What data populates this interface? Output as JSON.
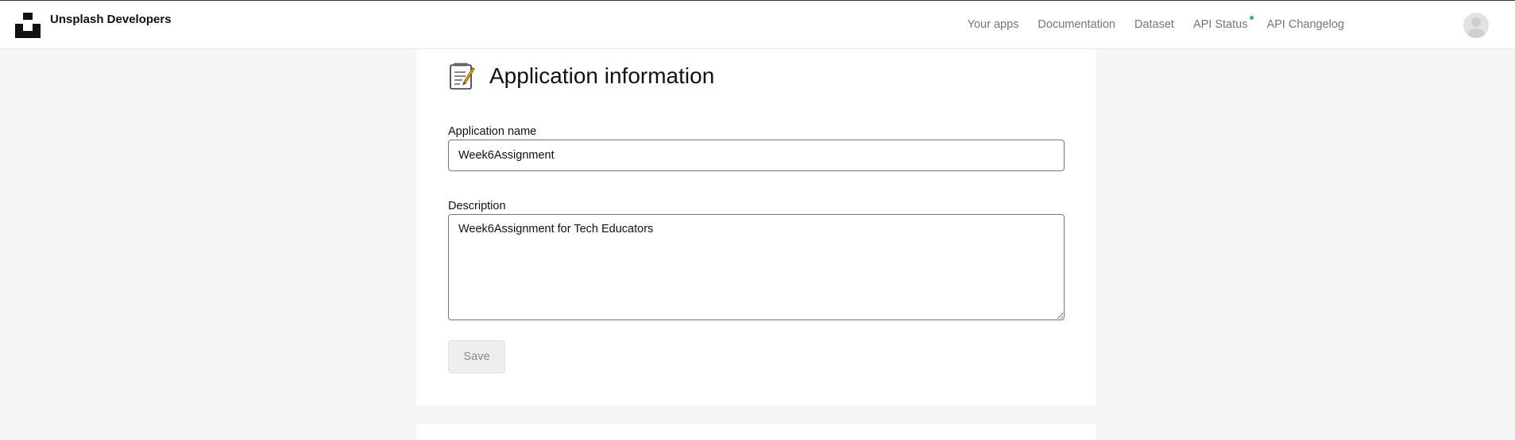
{
  "header": {
    "brand_name": "Unsplash Developers",
    "nav": [
      {
        "label": "Your apps"
      },
      {
        "label": "Documentation"
      },
      {
        "label": "Dataset"
      },
      {
        "label": "API Status",
        "status_color": "#2bb673"
      },
      {
        "label": "API Changelog"
      }
    ]
  },
  "section": {
    "icon": "memo-icon",
    "title": "Application information"
  },
  "form": {
    "app_name_label": "Application name",
    "app_name_value": "Week6Assignment",
    "description_label": "Description",
    "description_value": "Week6Assignment for Tech Educators",
    "save_label": "Save"
  }
}
